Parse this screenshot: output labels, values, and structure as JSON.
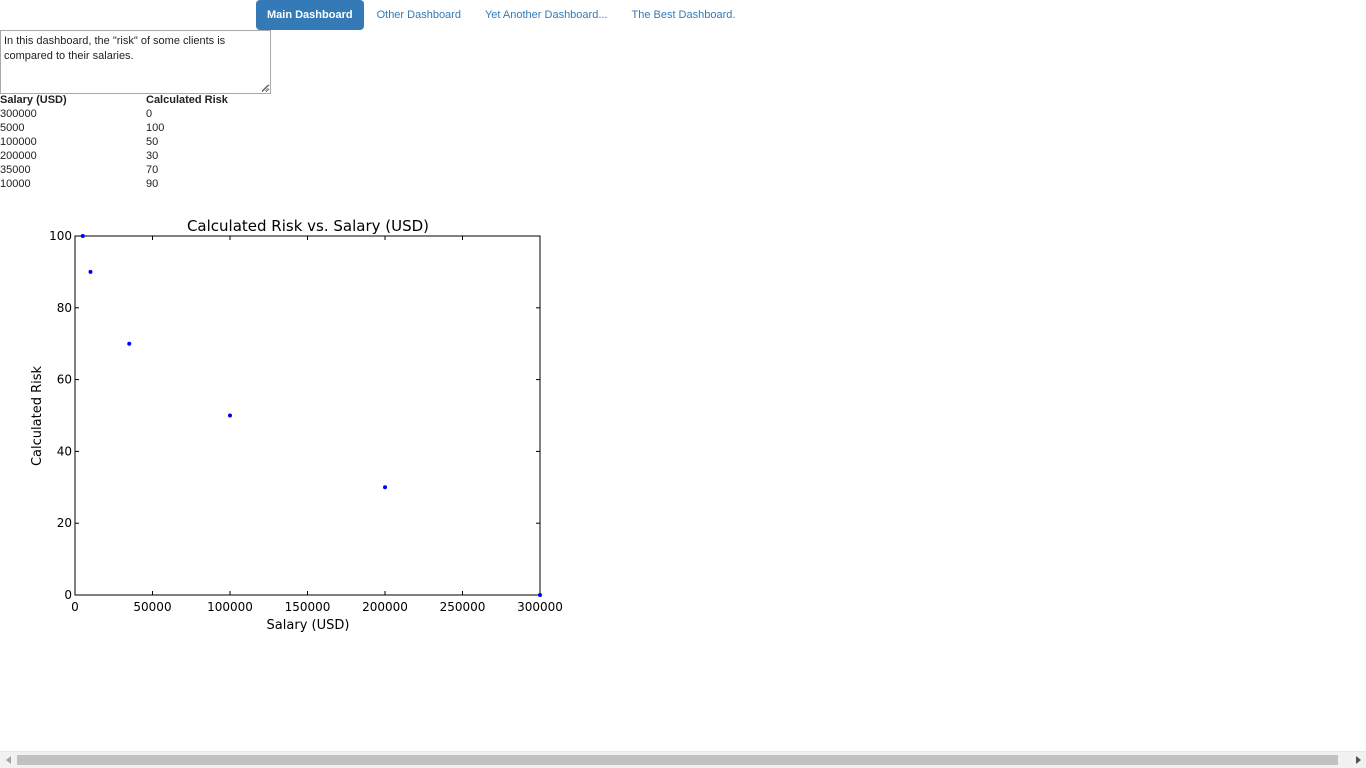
{
  "nav": {
    "tabs": [
      {
        "label": "Main Dashboard",
        "active": true
      },
      {
        "label": "Other Dashboard",
        "active": false
      },
      {
        "label": "Yet Another Dashboard...",
        "active": false
      },
      {
        "label": "The Best Dashboard.",
        "active": false
      }
    ]
  },
  "description": "In this dashboard, the \"risk\" of some clients is compared to their salaries.",
  "table": {
    "headers": [
      "Salary (USD)",
      "Calculated Risk"
    ],
    "rows": [
      [
        "300000",
        "0"
      ],
      [
        "5000",
        "100"
      ],
      [
        "100000",
        "50"
      ],
      [
        "200000",
        "30"
      ],
      [
        "35000",
        "70"
      ],
      [
        "10000",
        "90"
      ]
    ]
  },
  "chart_data": {
    "type": "scatter",
    "title": "Calculated Risk vs. Salary (USD)",
    "xlabel": "Salary (USD)",
    "ylabel": "Calculated Risk",
    "x": [
      300000,
      5000,
      100000,
      200000,
      35000,
      10000
    ],
    "y": [
      0,
      100,
      50,
      30,
      70,
      90
    ],
    "xlim": [
      0,
      300000
    ],
    "ylim": [
      0,
      100
    ],
    "xticks": [
      0,
      50000,
      100000,
      150000,
      200000,
      250000,
      300000
    ],
    "yticks": [
      0,
      20,
      40,
      60,
      80,
      100
    ],
    "grid": false,
    "point_color": "#0000ff"
  },
  "colors": {
    "accent": "#337ab7",
    "link": "#337ab7"
  },
  "icons": {
    "scroll_left": "triangle-left-icon",
    "scroll_right": "triangle-right-icon",
    "resize": "resize-grip-icon"
  }
}
